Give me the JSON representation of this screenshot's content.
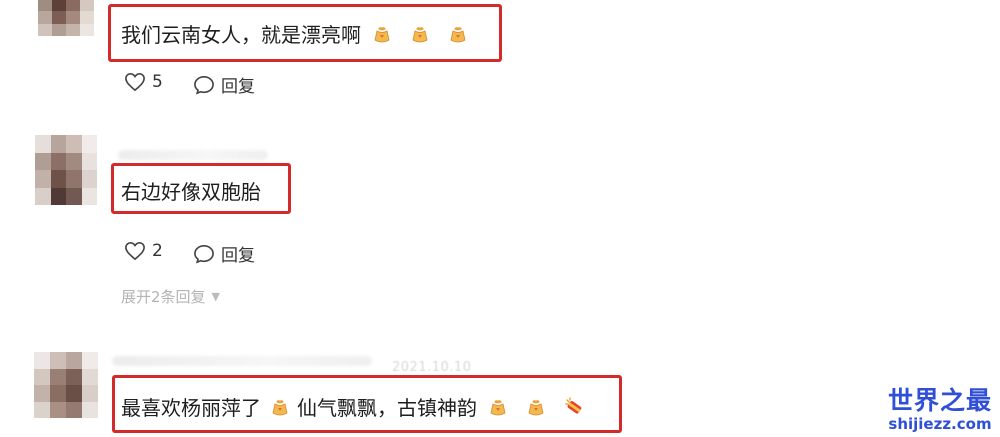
{
  "comments": [
    {
      "text_before": "我们云南女人，就是漂亮啊",
      "emojis": [
        "gift-bag",
        "gift-bag",
        "gift-bag"
      ],
      "likes": "5",
      "reply_label": "回复"
    },
    {
      "text_before": "右边好像双胞胎",
      "likes": "2",
      "reply_label": "回复",
      "expand_label": "展开2条回复"
    },
    {
      "date": "2021.10.10",
      "text_part1": "最喜欢杨丽萍了",
      "text_part2": "仙气飘飘，古镇神韵",
      "emojis": [
        "gift-bag",
        "gift-bag",
        "gift-bag",
        "firecracker"
      ]
    }
  ],
  "watermark": {
    "main": "世界之最",
    "sub": "shijiezz.com"
  },
  "colors": {
    "highlight_red": "#d42a2a",
    "watermark_blue": "#2f4fd6"
  }
}
